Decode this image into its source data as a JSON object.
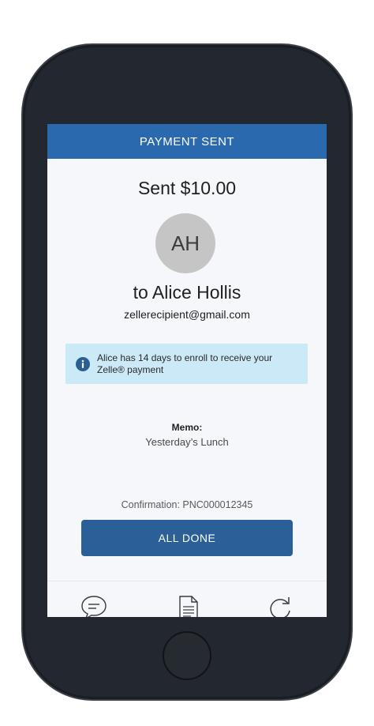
{
  "header": {
    "title": "PAYMENT SENT"
  },
  "payment": {
    "sent_text": "Sent $10.00",
    "avatar_initials": "AH",
    "recipient_line": "to Alice Hollis",
    "recipient_email": "zellerecipient@gmail.com"
  },
  "info": {
    "icon": "info-icon",
    "message": "Alice has 14 days to enroll to receive your Zelle® payment"
  },
  "memo": {
    "label": "Memo:",
    "value": "Yesterday’s Lunch"
  },
  "confirmation": {
    "text": "Confirmation: PNC000012345"
  },
  "actions": {
    "all_done_label": "ALL DONE"
  },
  "tab_bar": {
    "icons": [
      "chat-bubble-icon",
      "document-icon",
      "refresh-icon"
    ]
  },
  "colors": {
    "header": "#2a69ad",
    "button": "#2a6097",
    "info_background": "#cce9f7",
    "avatar": "#c5c5c5",
    "phone_frame": "#23272f"
  }
}
